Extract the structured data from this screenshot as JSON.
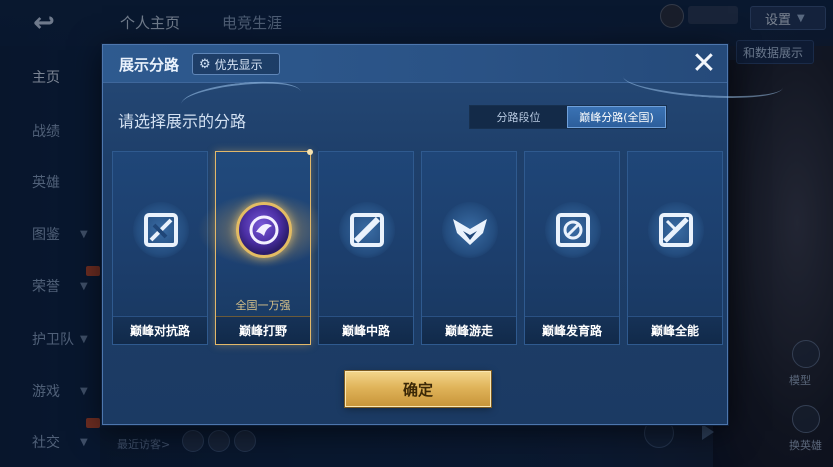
{
  "top": {
    "back_glyph": "↩",
    "tabs": [
      "个人主页",
      "电竞生涯"
    ],
    "settings_label": "设置",
    "right_pill_label": "和数据展示"
  },
  "sidebar": {
    "items": [
      {
        "label": "主页",
        "active": true
      },
      {
        "label": "战绩"
      },
      {
        "label": "英雄"
      },
      {
        "label": "图鉴",
        "chevron": true
      },
      {
        "label": "荣誉",
        "chevron": true
      },
      {
        "label": "护卫队",
        "chevron": true
      },
      {
        "label": "游戏",
        "chevron": true
      },
      {
        "label": "社交",
        "chevron": true
      }
    ]
  },
  "bottom": {
    "recent_visitors": "最近访客>",
    "model_label": "模型",
    "swap_hero_label": "换英雄"
  },
  "modal": {
    "title": "展示分路",
    "priority_label": "优先显示",
    "close_glyph": "✕",
    "prompt": "请选择展示的分路",
    "segments": [
      {
        "label": "分路段位",
        "active": false
      },
      {
        "label": "巅峰分路(全国)",
        "active": true
      }
    ],
    "cards": [
      {
        "name": "巅峰对抗路",
        "icon": "lane-top-icon"
      },
      {
        "name": "巅峰打野",
        "icon": "jungle-medal-icon",
        "selected": true,
        "rank": "全国一万强"
      },
      {
        "name": "巅峰中路",
        "icon": "lane-mid-icon"
      },
      {
        "name": "巅峰游走",
        "icon": "lane-roam-icon"
      },
      {
        "name": "巅峰发育路",
        "icon": "lane-bot-icon"
      },
      {
        "name": "巅峰全能",
        "icon": "lane-all-icon"
      }
    ],
    "confirm_label": "确定"
  },
  "colors": {
    "accent_gold": "#e0b45a",
    "modal_bg": "#1e3f6a",
    "segment_active": "#3a72b4"
  }
}
